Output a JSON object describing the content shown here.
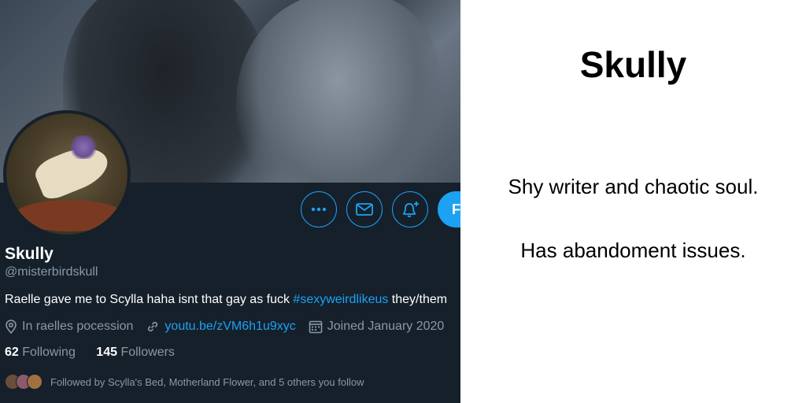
{
  "profile": {
    "display_name": "Skully",
    "handle": "@misterbirdskull",
    "bio_text": "Raelle gave me to Scylla haha isnt that gay as fuck ",
    "bio_hashtag": "#sexyweirdlikeus",
    "bio_tail": " they/them",
    "location": "In raelles pocession",
    "website": "youtu.be/zVM6h1u9xyc",
    "joined": "Joined January 2020",
    "following_count": "62",
    "following_label": "Following",
    "followers_count": "145",
    "followers_label": "Followers",
    "followed_by": "Followed by Scylla's Bed, Motherland Flower, and 5 others you follow",
    "follow_button_label": "Follow"
  },
  "icons": {
    "more": "more-horizontal-icon",
    "message": "envelope-icon",
    "notify": "bell-plus-icon",
    "location": "location-pin-icon",
    "link": "link-icon",
    "calendar": "calendar-icon"
  },
  "colors": {
    "accent": "#1da1f2",
    "background_dark": "#15202b",
    "secondary_text": "#8899a6"
  },
  "caption": {
    "title": "Skully",
    "line1": "Shy writer and chaotic soul.",
    "line2": "Has abandoment issues."
  }
}
